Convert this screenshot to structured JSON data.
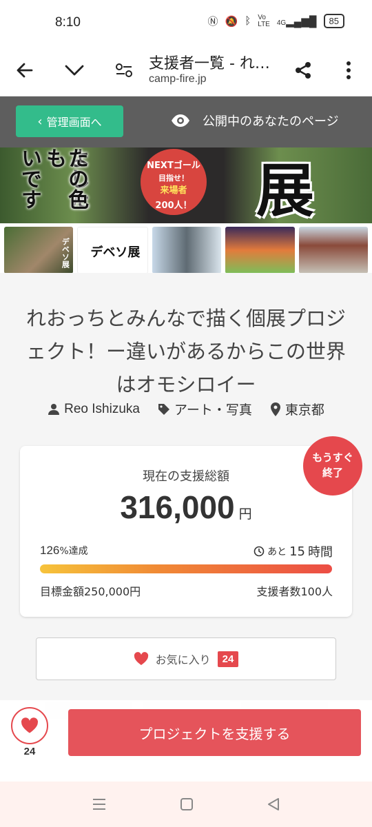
{
  "status_bar": {
    "time": "8:10",
    "network": "4G",
    "battery": "85"
  },
  "browser": {
    "page_title": "支援者一覧 - れ…",
    "domain": "camp-fire.jp"
  },
  "admin_bar": {
    "back_label": "管理画面へ",
    "public_page_label": "公開中のあなたのページ"
  },
  "hero": {
    "vertical_text_1": "よした",
    "vertical_text_2": "たの色も",
    "vertical_text_3": "いです",
    "badge_line1": "NEXTゴール",
    "badge_line2": "目指せ！",
    "badge_line3": "来場者",
    "badge_line4": "200人！",
    "big_text": "展"
  },
  "thumbnails": [
    {
      "name": "thumb-1",
      "label": "デベソ展"
    },
    {
      "name": "thumb-2",
      "label": "デベソ展"
    },
    {
      "name": "thumb-3",
      "label": ""
    },
    {
      "name": "thumb-4",
      "label": ""
    },
    {
      "name": "thumb-5",
      "label": ""
    }
  ],
  "project": {
    "title": "れおっちとみんなで描く個展プロジェクト！ー違いがあるからこの世界はオモシロイー",
    "owner": "Reo Ishizuka",
    "category": "アート・写真",
    "location": "東京都"
  },
  "funding": {
    "ending_badge_line1": "もうすぐ",
    "ending_badge_line2": "終了",
    "label": "現在の支援総額",
    "amount": "316,000",
    "currency": "円",
    "rate_value": "126",
    "rate_suffix": "%達成",
    "remain_prefix": "あと",
    "remain_value": "15",
    "remain_unit": "時間",
    "goal": "目標金額250,000円",
    "backers": "支援者数100人",
    "progress_fraction": 1.0
  },
  "favorite": {
    "label": "お気に入り",
    "count": "24"
  },
  "action_bar": {
    "like_count": "24",
    "support_label": "プロジェクトを支援する"
  },
  "colors": {
    "accent": "#e5484d",
    "admin_green": "#33bc8b",
    "admin_bar": "#5e5e5e"
  }
}
